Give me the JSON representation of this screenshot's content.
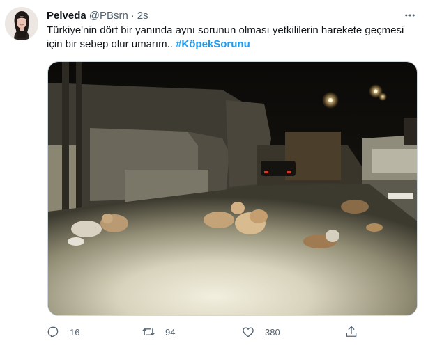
{
  "tweet": {
    "author": {
      "name": "Pelveda",
      "handle": "@PBsrn",
      "separator": "·",
      "time": "2s"
    },
    "text": "Türkiye'nin dört bir yanında aynı sorunun olması yetkililerin harekete geçmesi için bir sebep olur umarım..",
    "hashtag": "#KöpekSorunu",
    "stats": {
      "replies": "16",
      "retweets": "94",
      "likes": "380"
    }
  },
  "colors": {
    "accent": "#1d9bf0",
    "text_primary": "#0f1419",
    "text_secondary": "#536471",
    "border": "#cfd9de"
  },
  "icons": {
    "more": "more-horizontal-icon",
    "reply": "reply-icon",
    "retweet": "retweet-icon",
    "like": "heart-icon",
    "share": "share-icon"
  }
}
